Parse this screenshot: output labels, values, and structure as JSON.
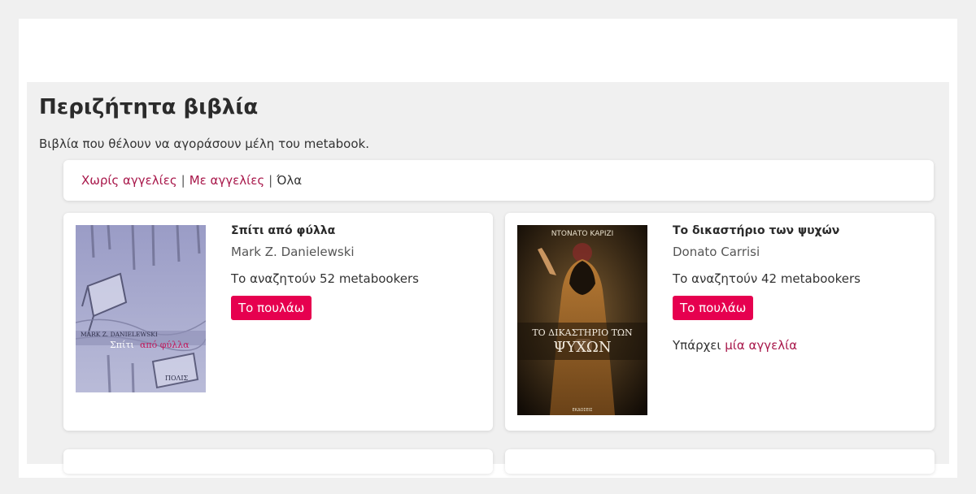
{
  "header": {
    "title": "Περιζήτητα βιβλία",
    "subtitle": "Βιβλία που θέλουν να αγοράσουν μέλη του metabook."
  },
  "filters": {
    "without_listings": "Χωρίς αγγελίες",
    "separator": "|",
    "with_listings": "Με αγγελίες",
    "all": "Όλα"
  },
  "books": [
    {
      "title": "Σπίτι από φύλλα",
      "author": "Mark Z. Danielewski",
      "wanted": "Το αναζητούν 52 metabookers",
      "sell_label": "Το πουλάω",
      "cover": {
        "author_text": "MARK Z. DANIELEWSKI",
        "title_plain": "Σπίτι",
        "title_accent": "από φύλλα",
        "publisher": "ΠΟΛΙΣ"
      }
    },
    {
      "title": "Το δικαστήριο των ψυχών",
      "author": "Donato Carrisi",
      "wanted": "Το αναζητούν 42 metabookers",
      "sell_label": "Το πουλάω",
      "listing_prefix": "Υπάρχει",
      "listing_link": "μία αγγελία",
      "cover": {
        "author_text": "ΝΤΟΝΑΤΟ ΚΑΡΙΖΙ",
        "title_line1": "ΤΟ ΔΙΚΑΣΤΗΡΙΟ ΤΩΝ",
        "title_line2": "ΨΥΧΩΝ",
        "publisher": "ΕΚΔΟΣΕΙΣ"
      }
    }
  ]
}
